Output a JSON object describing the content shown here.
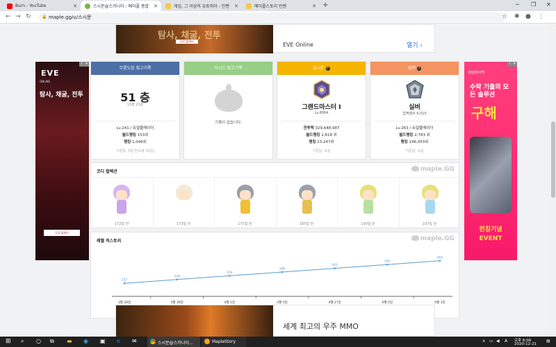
{
  "browser": {
    "tabs": [
      {
        "label": "Burn - YouTube",
        "icon_color": "#ff0000"
      },
      {
        "label": "스시문@스카니아 : 메이플 종합",
        "icon_color": "#7ab648"
      },
      {
        "label": "게임, 그 이상의 유토피아 - 인벤",
        "icon_color": "#f7c948"
      },
      {
        "label": "메이플스토리 인벤",
        "icon_color": "#f7c948"
      }
    ],
    "url": "maple.gg/u/스시문"
  },
  "ads": {
    "top": {
      "image_text": "탐사, 채굴, 전투",
      "image_button": "무료 플레이",
      "name": "EVE Online",
      "open": "열기"
    },
    "left": {
      "logo": "EVE",
      "sub": "ONLINE",
      "headline": "탐사, 채굴, 전투",
      "button": "무료 플레이"
    },
    "right": {
      "brand": "대성마이맥",
      "headline": "수학 기출의 모든 솔루션",
      "big": "구해",
      "event": "런칭기념 EVENT"
    },
    "bottom": {
      "image_text": "",
      "name": "세계 최고의 우주 MMO"
    }
  },
  "cards": {
    "mureung": {
      "title": "무릉도장 최고기록",
      "floor": "51 층",
      "time": "13분 23초",
      "level_job": "Lv.241 / 듀얼블레이더",
      "world_rank_label": "월드랭킹",
      "world_rank": "153위",
      "rank_label": "랭킹",
      "rank": "1,046위",
      "footer": "기준일: 3일 전(1월 19일)"
    },
    "theseed": {
      "title": "더시드 최고기록",
      "empty": "기록이 없습니다."
    },
    "union": {
      "title": "유니온",
      "grade": "그랜드마스터 I",
      "level": "Lv.8064",
      "power_label": "전투력",
      "power": "329,648,987",
      "world_rank_label": "월드랭킹",
      "world_rank": "1,618 위",
      "rank_label": "랭킹",
      "rank": "23,247위",
      "footer": "기준일: 오늘"
    },
    "achievement": {
      "title": "업적",
      "grade": "실버",
      "score": "업적점수 6,010",
      "level_job": "Lv.263 / 듀얼블레이더",
      "world_rank_label": "월드랭킹",
      "world_rank": "2,783 위",
      "rank_label": "랭킹",
      "rank": "146,453위",
      "footer": "기준일: 오늘"
    }
  },
  "coordi": {
    "title": "코디 컬렉션",
    "logo": "maple.GG",
    "items": [
      {
        "label": "172일 전",
        "hair": "#d8b4f0",
        "body": "#c9a6e8"
      },
      {
        "label": "173일 전",
        "hair": "#f3ead8",
        "body": "#ffffff"
      },
      {
        "label": "175일 전",
        "hair": "#9aa0a8",
        "body": "#f0c030"
      },
      {
        "label": "185일 전",
        "hair": "#9aa0a8",
        "body": "#e8c050"
      },
      {
        "label": "190일 전",
        "hair": "#e8e07a",
        "body": "#b8e0a0"
      },
      {
        "label": "197일 전",
        "hair": "#e8e07a",
        "body": "#a8d8f0"
      }
    ]
  },
  "level_history": {
    "title": "레벨 히스토리",
    "logo": "maple.GG"
  },
  "chart_data": {
    "type": "line",
    "x": [
      "3월 28일",
      "3월 30일",
      "4월 1일",
      "4월 3일",
      "4월 27일",
      "6월 2일",
      "6월 3일"
    ],
    "series": [
      {
        "values": [
          257,
          258,
          259,
          260,
          261,
          262,
          263
        ]
      }
    ],
    "ylim": [
      255,
      265
    ],
    "grid": false,
    "color": "#5b9bd5"
  },
  "taskbar": {
    "apps": [
      {
        "label": "스시문@스카니아..."
      },
      {
        "label": "MapleStory"
      }
    ],
    "ime": "A",
    "time": "오후 8:06",
    "date": "2020-12-21"
  }
}
